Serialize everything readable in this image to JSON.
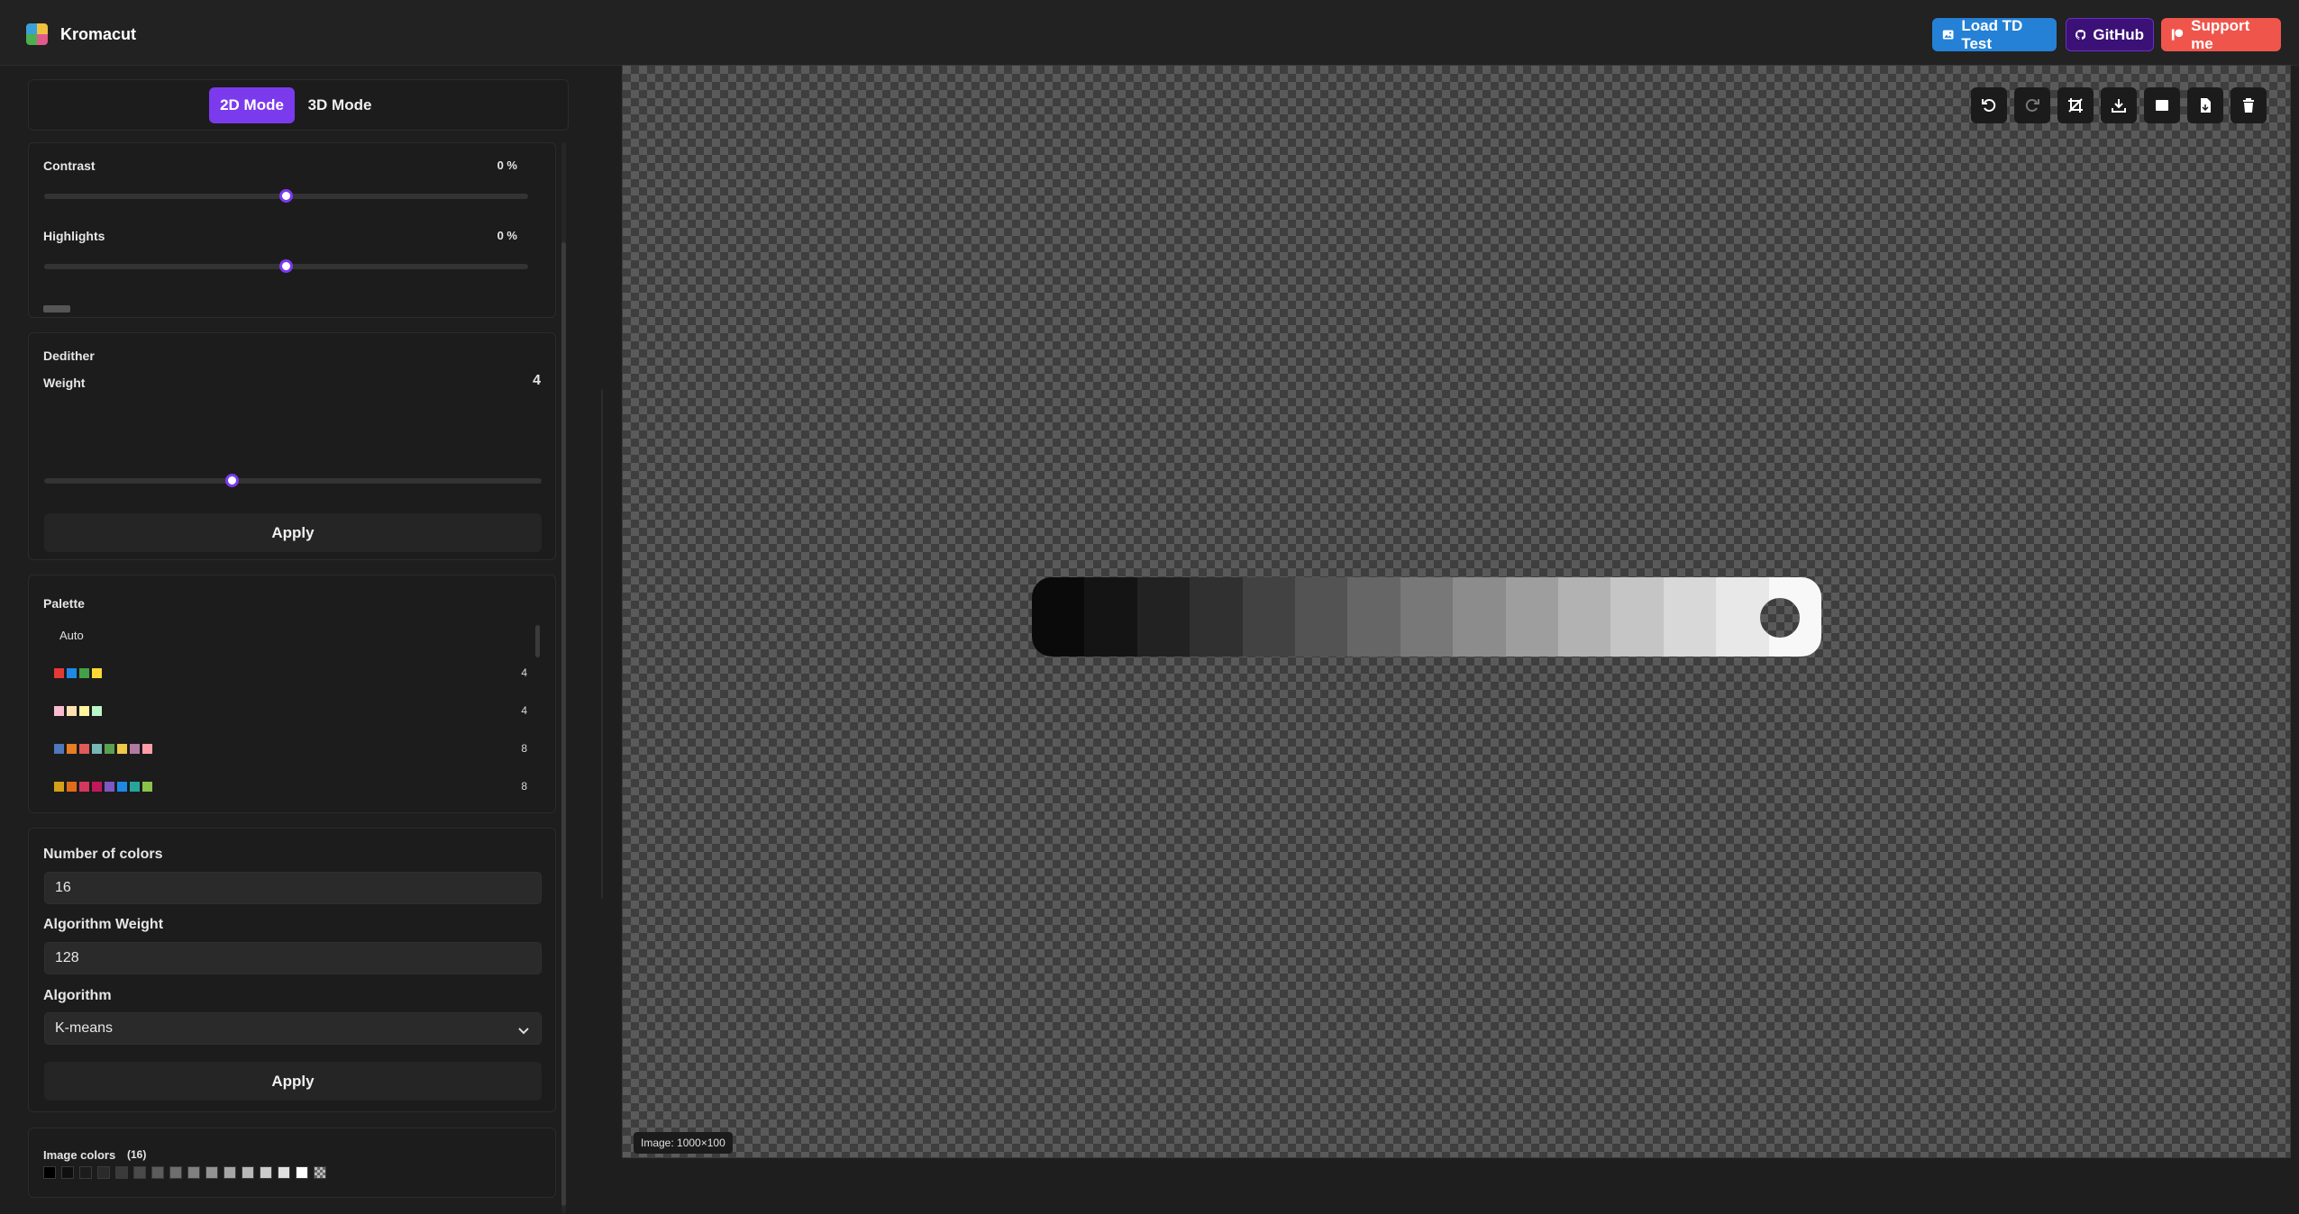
{
  "app": {
    "title": "Kromacut"
  },
  "header": {
    "load_btn": "Load TD Test",
    "github_btn": "GitHub",
    "support_btn": "Support me"
  },
  "modes": {
    "mode_2d": "2D Mode",
    "mode_3d": "3D Mode",
    "active": "2D Mode"
  },
  "adjustments": {
    "items": [
      {
        "label": "Contrast",
        "value": "0 %"
      },
      {
        "label": "Highlights",
        "value": "0 %"
      }
    ]
  },
  "dedither": {
    "title": "Dedither",
    "weight_label": "Weight",
    "weight_value": "4",
    "apply": "Apply"
  },
  "palette": {
    "title": "Palette",
    "auto": "Auto",
    "presets": [
      {
        "colors": [
          "#e53935",
          "#1e88e5",
          "#43a047",
          "#fdd835"
        ],
        "count": "4"
      },
      {
        "colors": [
          "#f8bbd0",
          "#ffe0b2",
          "#fff59d",
          "#b9f6ca"
        ],
        "count": "4"
      },
      {
        "colors": [
          "#4f77b9",
          "#e67e22",
          "#e05a5a",
          "#76b7b2",
          "#59a14f",
          "#edc948",
          "#b07aa1",
          "#ff9da7"
        ],
        "count": "8"
      },
      {
        "colors": [
          "#d4a017",
          "#e06c1a",
          "#d6375e",
          "#c2185b",
          "#7e57c2",
          "#1e88e5",
          "#26a69a",
          "#8bc34a"
        ],
        "count": "8"
      }
    ]
  },
  "quantize": {
    "colors_label": "Number of colors",
    "colors_value": "16",
    "weight_label": "Algorithm Weight",
    "weight_value": "128",
    "algorithm_label": "Algorithm",
    "algorithm_value": "K-means",
    "apply": "Apply"
  },
  "image_colors": {
    "title": "Image colors",
    "count": "(16)",
    "swatches": [
      "#000000",
      "#0f0f0f",
      "#1c1c1c",
      "#2a2a2a",
      "#3a3a3a",
      "#4a4a4a",
      "#5c5c5c",
      "#6e6e6e",
      "#808080",
      "#939393",
      "#a6a6a6",
      "#b9b9b9",
      "#cccccc",
      "#e0e0e0",
      "#ffffff",
      "transparent"
    ]
  },
  "canvas": {
    "image_size": "Image: 1000×100",
    "gradient_steps": [
      "#0a0a0a",
      "#141414",
      "#222222",
      "#303030",
      "#424242",
      "#535353",
      "#666666",
      "#787878",
      "#8c8c8c",
      "#9e9e9e",
      "#b2b2b2",
      "#c5c5c5",
      "#d8d8d8",
      "#e8e8e8",
      "#f8f8f8"
    ],
    "tools": [
      "undo-icon",
      "redo-icon",
      "crop-icon",
      "download-icon",
      "square-icon",
      "file-icon",
      "trash-icon"
    ]
  },
  "colors": {
    "accent": "#7c3aed",
    "load_btn": "#2481d6",
    "github_btn": "#3b1077",
    "support_btn": "#f0554c"
  }
}
